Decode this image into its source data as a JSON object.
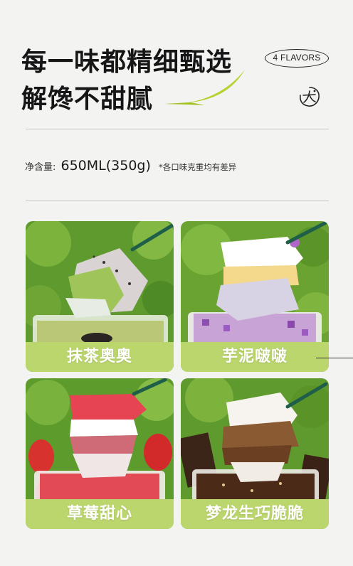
{
  "header": {
    "title_line1": "每一味都精细甄选",
    "title_line2": "解馋不甜腻",
    "badge_text": "4 FLAVORS",
    "accent_color": "#b5d333"
  },
  "net_content": {
    "label": "净含量:",
    "value": "650ML(350g)",
    "note": "*各口味克重均有差异"
  },
  "flavors": [
    {
      "name": "抹茶奥奥",
      "theme": "matcha-oreo"
    },
    {
      "name": "芋泥啵啵",
      "theme": "taro-boba"
    },
    {
      "name": "草莓甜心",
      "theme": "strawberry"
    },
    {
      "name": "梦龙生巧脆脆",
      "theme": "chocolate-crunch"
    }
  ],
  "card_label_bg": "#bcd66e"
}
